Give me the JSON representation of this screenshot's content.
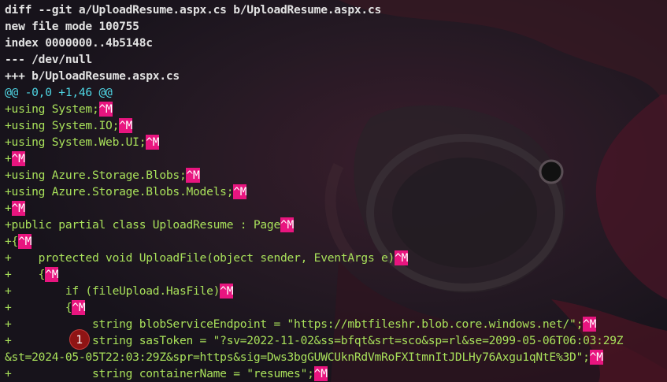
{
  "diff": {
    "header": [
      "diff --git a/UploadResume.aspx.cs b/UploadResume.aspx.cs",
      "new file mode 100755",
      "index 0000000..4b5148c",
      "--- /dev/null",
      "+++ b/UploadResume.aspx.cs"
    ],
    "hunk": "@@ -0,0 +1,46 @@",
    "lines": [
      "+using System;",
      "+using System.IO;",
      "+using System.Web.UI;",
      "+",
      "+using Azure.Storage.Blobs;",
      "+using Azure.Storage.Blobs.Models;",
      "+",
      "+public partial class UploadResume : Page",
      "+{",
      "+    protected void UploadFile(object sender, EventArgs e)",
      "+    {",
      "+        if (fileUpload.HasFile)",
      "+        {",
      "+            string blobServiceEndpoint = \"https://mbtfileshr.blob.core.windows.net/\";",
      "+            string sasToken = \"?sv=2022-11-02&ss=bfqt&srt=sco&sp=rl&se=2099-05-06T06:03:29Z",
      "&st=2024-05-05T22:03:29Z&spr=https&sig=Dws3bgGUWCUknRdVmRoFXItmnItJDLHy76Axgu1qNtE%3D\";",
      "+            string containerName = \"resumes\";"
    ],
    "cr_marker": "^M",
    "annotation_marker": "1"
  },
  "colors": {
    "background": "#1c1620",
    "meta_text": "#e2e2e2",
    "hunk_text": "#4fd6e4",
    "added_text": "#a8e05a",
    "cr_highlight": "#e8157f",
    "annotation_marker": "#8f1414"
  }
}
